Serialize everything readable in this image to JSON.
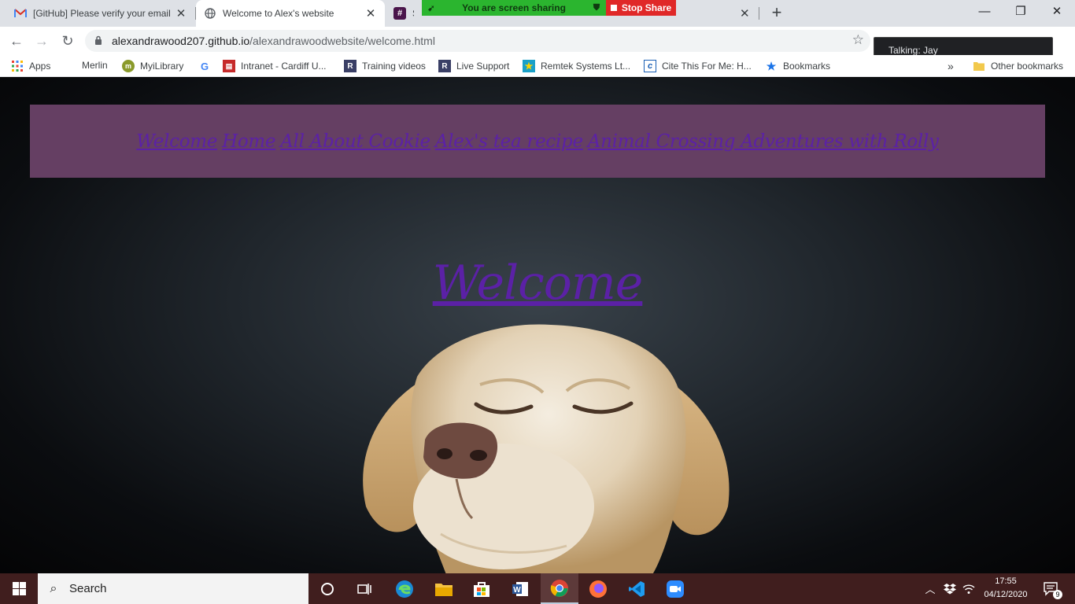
{
  "browser": {
    "tabs": [
      {
        "title": "[GitHub] Please verify your email",
        "favicon": "gmail-icon"
      },
      {
        "title": "Welcome to Alex's website",
        "favicon": "globe-icon"
      },
      {
        "title": "Sla",
        "favicon": "slack-icon"
      }
    ],
    "new_tab": "+",
    "window_controls": {
      "minimize": "—",
      "restore": "❐",
      "close": "✕"
    },
    "screen_share": {
      "status": "You are screen sharing",
      "stop_label": "Stop Share"
    },
    "address": {
      "host": "alexandrawood207.github.io",
      "path": "/alexandrawoodwebsite/welcome.html"
    },
    "talking_toast": "Talking: Jay",
    "bookmarks": [
      {
        "label": "Apps",
        "icon": "apps-grid-icon"
      },
      {
        "label": "Merlin",
        "icon": ""
      },
      {
        "label": "MyiLibrary",
        "icon": "myilibrary-icon"
      },
      {
        "label": "",
        "icon": "google-icon"
      },
      {
        "label": "Intranet - Cardiff U...",
        "icon": "intranet-icon"
      },
      {
        "label": "Training videos",
        "icon": "remtek-icon"
      },
      {
        "label": "Live Support",
        "icon": "remtek-icon"
      },
      {
        "label": "Remtek Systems Lt...",
        "icon": "star-icon"
      },
      {
        "label": "Cite This For Me: H...",
        "icon": "cite-icon"
      },
      {
        "label": "Bookmarks",
        "icon": "star-icon"
      }
    ],
    "bookmarks_overflow": "»",
    "other_bookmarks": "Other bookmarks"
  },
  "site": {
    "nav": [
      "Welcome",
      "Home",
      "All About Cookie",
      "Alex's tea recipe",
      "Animal Crossing Adventures with Rolly"
    ],
    "heading": "Welcome",
    "colors": {
      "nav_band": "#653f63",
      "link": "#5b21a6"
    }
  },
  "taskbar": {
    "search_label": "Search",
    "pinned": [
      "cortana-icon",
      "task-view-icon",
      "edge-icon",
      "file-explorer-icon",
      "store-icon",
      "word-icon",
      "chrome-icon",
      "firefox-icon",
      "vscode-icon",
      "zoom-icon"
    ],
    "time": "17:55",
    "date": "04/12/2020",
    "notifications": "9"
  }
}
